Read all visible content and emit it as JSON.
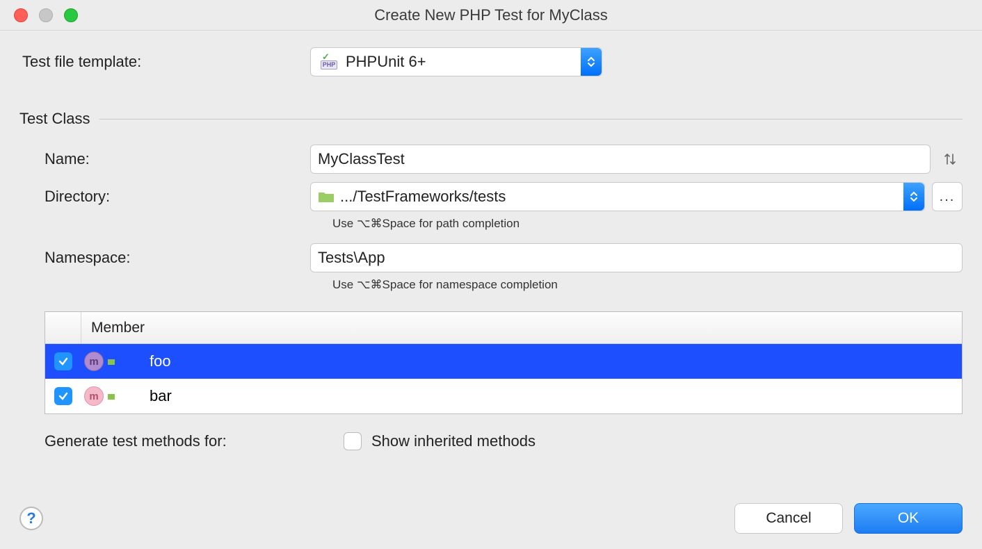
{
  "window": {
    "title": "Create New PHP Test for MyClass"
  },
  "template": {
    "label": "Test file template:",
    "value": "PHPUnit 6+"
  },
  "fieldset": {
    "title": "Test Class"
  },
  "name": {
    "label": "Name:",
    "value": "MyClassTest"
  },
  "directory": {
    "label": "Directory:",
    "value": ".../TestFrameworks/tests",
    "hint": "Use ⌥⌘Space for path completion",
    "browse": "..."
  },
  "namespace": {
    "label": "Namespace:",
    "value": "Tests\\App",
    "hint": "Use ⌥⌘Space for namespace completion"
  },
  "members": {
    "header": "Member",
    "rows": [
      {
        "name": "foo",
        "checked": true,
        "selected": true
      },
      {
        "name": "bar",
        "checked": true,
        "selected": false
      }
    ]
  },
  "generate": {
    "label": "Generate test methods for:",
    "inherited_label": "Show inherited methods",
    "inherited_checked": false
  },
  "buttons": {
    "cancel": "Cancel",
    "ok": "OK",
    "help": "?"
  }
}
